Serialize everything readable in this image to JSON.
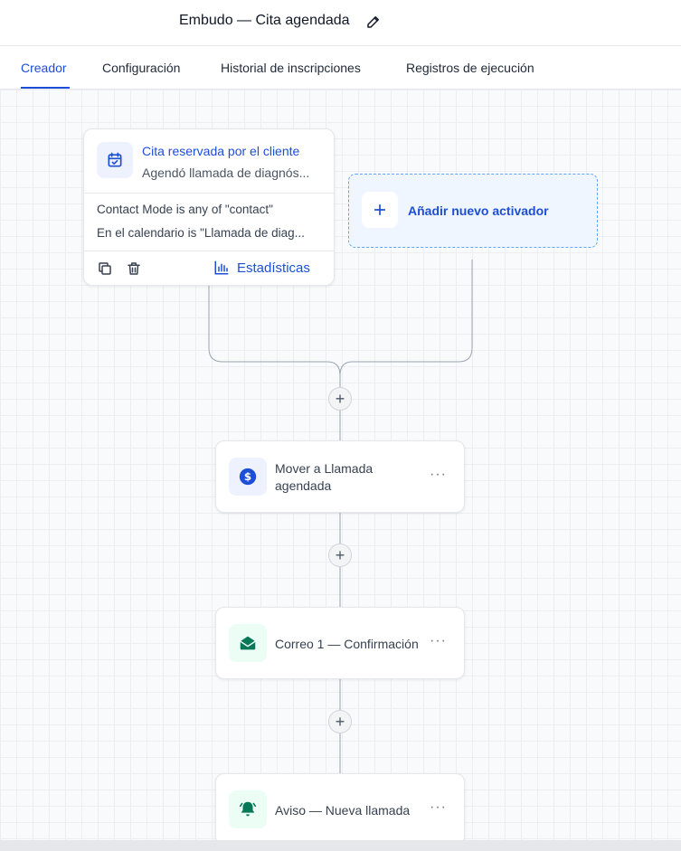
{
  "header": {
    "title": "Embudo — Cita agendada"
  },
  "tabs": [
    {
      "label": "Creador",
      "active": true
    },
    {
      "label": "Configuración",
      "active": false
    },
    {
      "label": "Historial de inscripciones",
      "active": false
    },
    {
      "label": "Registros de ejecución",
      "active": false
    }
  ],
  "trigger": {
    "title": "Cita reservada por el cliente",
    "subtitle": "Agendó llamada de diagnós...",
    "conditions": [
      "Contact Mode is any of \"contact\"",
      "En el calendario is \"Llamada de diag..."
    ],
    "stats_label": "Estadísticas"
  },
  "add_trigger": {
    "label": "Añadir nuevo activador"
  },
  "actions": [
    {
      "label_line1": "Mover a Llamada",
      "label_line2": "agendada"
    },
    {
      "label": "Correo 1 — Confirmación"
    },
    {
      "label": "Aviso — Nueva llamada"
    }
  ],
  "node_add_symbol": "+",
  "more_symbol": "···",
  "colors": {
    "accent": "#1d4ed8",
    "green": "#047857",
    "green_bg": "#ecfdf5"
  }
}
